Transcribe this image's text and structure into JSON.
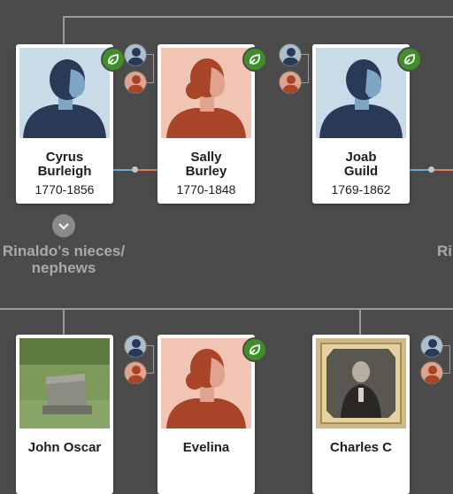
{
  "colors": {
    "background": "#4b4b4b",
    "connector": "#9a9a9a",
    "hint_green": "#3f8f2b",
    "male_bg": "#c9dbe6",
    "female_bg": "#f2c4b4",
    "spouse_line_male": "#6fa9c8",
    "spouse_line_female": "#e07a5c"
  },
  "row1": [
    {
      "first": "Cyrus",
      "last": "Burleigh",
      "dates": "1770-1856",
      "gender": "male"
    },
    {
      "first": "Sally",
      "last": "Burley",
      "dates": "1770-1848",
      "gender": "female"
    },
    {
      "first": "Joab",
      "last": "Guild",
      "dates": "1769-1862",
      "gender": "male"
    }
  ],
  "row2": [
    {
      "first": "John Oscar",
      "gender": "photo-grave"
    },
    {
      "first": "Evelina",
      "gender": "female"
    },
    {
      "first": "Charles C",
      "gender": "photo-portrait"
    }
  ],
  "group": {
    "label_line1": "Rinaldo's nieces/",
    "label_line2": "nephews",
    "right_partial": "Ri"
  },
  "icons": {
    "hint": "leaf-hint-icon",
    "expand": "chevron-down-icon"
  }
}
